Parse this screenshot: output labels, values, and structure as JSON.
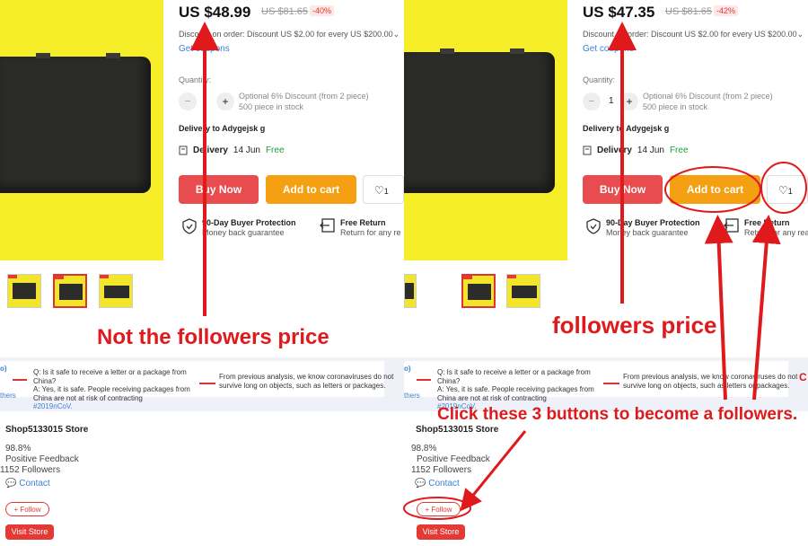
{
  "left": {
    "price": "US $48.99",
    "old_price": "US $81.65",
    "discount": "-40%",
    "order_discount": "Discount on order: Discount US $2.00 for every US $200.00",
    "coupons": "Get coupons",
    "quantity_label": "Quantity:",
    "qty_minus": "−",
    "qty_value": "",
    "qty_plus": "+",
    "qty_note_1": "Optional 6% Discount (from 2 piece)",
    "qty_note_2": "500 piece in stock",
    "deliver_to": "Delivery to Adygejsk g",
    "delivery_label": "Delivery",
    "delivery_date": "14 Jun",
    "delivery_free": "Free",
    "buy_now": "Buy Now",
    "add_to_cart": "Add to cart",
    "wish_count": "1",
    "protection_title": "90-Day Buyer Protection",
    "protection_sub": "Money back guarantee",
    "return_title": "Free Return",
    "return_sub": "Return for any re",
    "annotation": "Not the followers price"
  },
  "right": {
    "price": "US $47.35",
    "old_price": "US $81.65",
    "discount": "-42%",
    "order_discount": "Discount on order: Discount US $2.00 for every US $200.00",
    "coupons": "Get coupons",
    "quantity_label": "Quantity:",
    "qty_minus": "−",
    "qty_value": "1",
    "qty_plus": "+",
    "qty_note_1": "Optional 6% Discount (from 2 piece)",
    "qty_note_2": "500 piece in stock",
    "deliver_to": "Delivery to Adygejsk g",
    "delivery_label": "Delivery",
    "delivery_date": "14 Jun",
    "delivery_free": "Free",
    "buy_now": "Buy Now",
    "add_to_cart": "Add to cart",
    "wish_count": "1",
    "protection_title": "90-Day Buyer Protection",
    "protection_sub": "Money back guarantee",
    "return_title": "Free Return",
    "return_sub": "Return for any rea",
    "annotation_price": "followers price",
    "annotation_click": "Click these 3 buttons to become a followers."
  },
  "banner": {
    "question": "Q: Is it safe to receive a letter or a package from China?",
    "answer": "A: Yes, it is safe. People receiving packages from China are not at risk of contracting",
    "hashtag": "#2019nCoV.",
    "analysis": "From previous analysis, we know coronaviruses do not survive long on objects, such as letters or packages.",
    "others": "thers",
    "left_edge_mark": "o)",
    "right_edge_mark": "C"
  },
  "store": {
    "name": "Shop5133015 Store",
    "feedback_pct": "98.8%",
    "feedback_label": "Positive Feedback",
    "followers": "1152 Followers",
    "contact": "Contact",
    "follow": "+ Follow",
    "visit": "Visit Store"
  },
  "colors": {
    "annotation_red": "#e0191c",
    "buy_now": "#e94c4f",
    "add_to_cart": "#f5a012",
    "product_yellow": "#f7ee2a",
    "link_blue": "#3d7fd6"
  }
}
